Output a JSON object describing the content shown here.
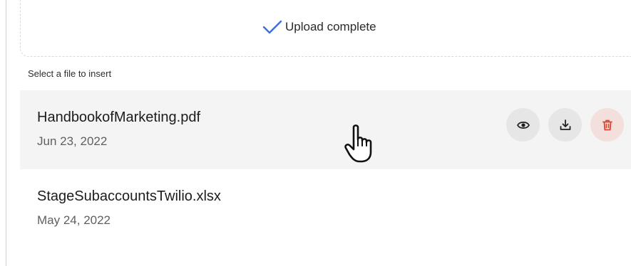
{
  "upload": {
    "status_text": "Upload complete",
    "progress": 1.0,
    "accent_color": "#3d6fd6"
  },
  "file_list": {
    "label": "Select a file to insert",
    "files": [
      {
        "name": "HandbookofMarketing.pdf",
        "date": "Jun 23, 2022",
        "hovered": true,
        "actions": [
          "eye-icon",
          "download-icon",
          "trash-icon"
        ]
      },
      {
        "name": "StageSubaccountsTwilio.xlsx",
        "date": "May 24, 2022",
        "hovered": false
      }
    ]
  },
  "colors": {
    "delete_icon": "#e0442f",
    "row_hover_bg": "#f4f4f4"
  }
}
